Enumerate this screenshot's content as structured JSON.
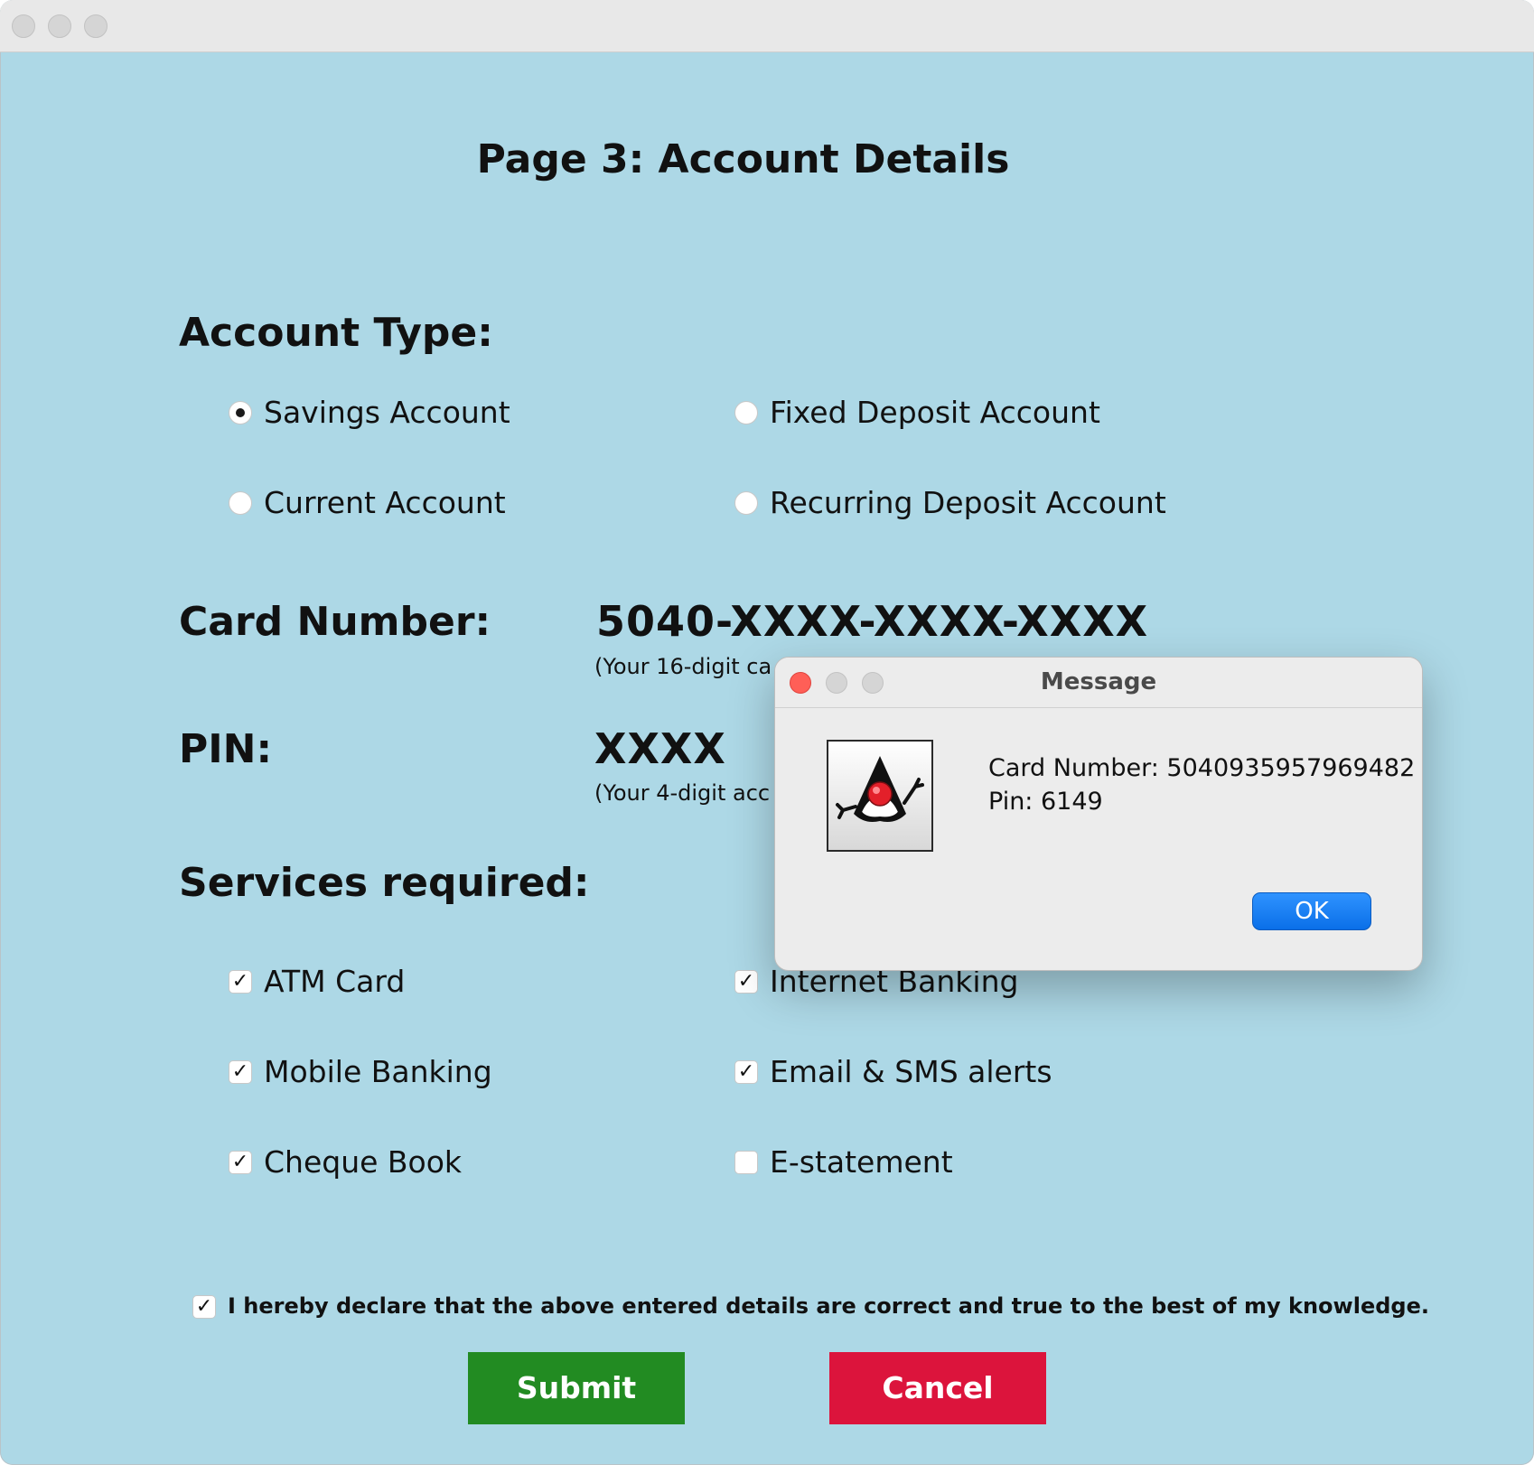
{
  "page": {
    "title": "Page 3: Account Details"
  },
  "account_type": {
    "heading": "Account Type:",
    "options": [
      {
        "label": "Savings Account",
        "selected": true
      },
      {
        "label": "Fixed Deposit Account",
        "selected": false
      },
      {
        "label": "Current Account",
        "selected": false
      },
      {
        "label": "Recurring Deposit Account",
        "selected": false
      }
    ]
  },
  "card": {
    "heading": "Card Number:",
    "value": "5040-XXXX-XXXX-XXXX",
    "hint": "(Your 16-digit ca"
  },
  "pin": {
    "heading": "PIN:",
    "value": "XXXX",
    "hint": "(Your 4-digit acc"
  },
  "services": {
    "heading": "Services required:",
    "items": [
      {
        "label": "ATM Card",
        "checked": true
      },
      {
        "label": "Internet Banking",
        "checked": true
      },
      {
        "label": "Mobile Banking",
        "checked": true
      },
      {
        "label": "Email & SMS alerts",
        "checked": true
      },
      {
        "label": "Cheque Book",
        "checked": true
      },
      {
        "label": "E-statement",
        "checked": false
      }
    ]
  },
  "declaration": {
    "text": "I hereby declare that the above entered details are correct and true to the best of my knowledge.",
    "checked": true
  },
  "buttons": {
    "submit": "Submit",
    "cancel": "Cancel"
  },
  "dialog": {
    "title": "Message",
    "line1": "Card Number: 5040935957969482",
    "line2": "Pin: 6149",
    "ok": "OK",
    "icon": "java-duke-icon"
  },
  "colors": {
    "background": "#add8e6",
    "submit": "#228b22",
    "cancel": "#dc143c",
    "ok_button": "#0a6fe8",
    "dialog_close": "#ff5f57"
  }
}
